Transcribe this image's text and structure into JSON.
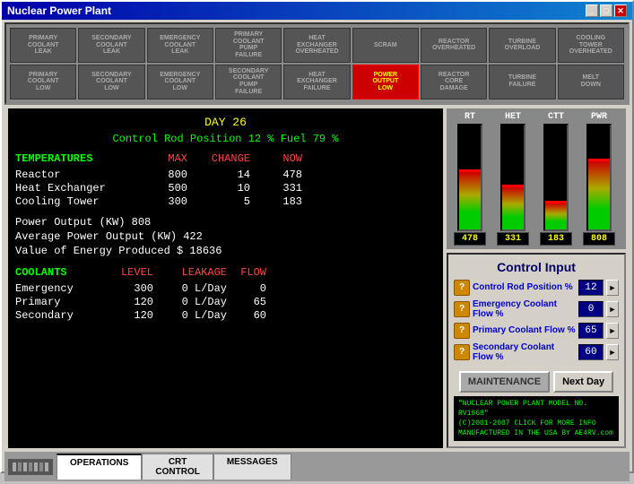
{
  "window": {
    "title": "Nuclear Power Plant",
    "min_btn": "_",
    "max_btn": "□",
    "close_btn": "✕"
  },
  "alerts": {
    "row1": [
      {
        "label": "PRIMARY\nCOOLANT\nLEAK",
        "active": false
      },
      {
        "label": "SECONDARY\nCOOLANT\nLEAK",
        "active": false
      },
      {
        "label": "EMERGENCY\nCOOLANT\nLEAK",
        "active": false
      },
      {
        "label": "PRIMARY\nCOOLANT\nPUMP\nFAILURE",
        "active": false
      },
      {
        "label": "HEAT\nEXCHANGER\nOVERHEATED",
        "active": false
      },
      {
        "label": "SCRAM",
        "active": false
      },
      {
        "label": "REACTOR\nOVERHEATED",
        "active": false
      },
      {
        "label": "TURBINE\nOVERLOAD",
        "active": false
      },
      {
        "label": "COOLING\nTOWER\nOVERHEATED",
        "active": false
      },
      {
        "label": "",
        "active": false
      }
    ],
    "row2": [
      {
        "label": "PRIMARY\nCOOLANT\nLOW",
        "active": false
      },
      {
        "label": "SECONDARY\nCOOLANT\nLOW",
        "active": false
      },
      {
        "label": "EMERGENCY\nCOOLANT\nLOW",
        "active": false
      },
      {
        "label": "SECONDARY\nCOOLANT\nPUMP\nFAILURE",
        "active": false
      },
      {
        "label": "HEAT\nEXCHANGER\nFAILURE",
        "active": false
      },
      {
        "label": "POWER\nOUTPUT\nLOW",
        "active": true
      },
      {
        "label": "REACTOR\nCORE\nDAMAGE",
        "active": false
      },
      {
        "label": "TURBINE\nFAILURE",
        "active": false
      },
      {
        "label": "MELT\nDOWN",
        "active": false
      },
      {
        "label": "",
        "active": false
      }
    ]
  },
  "info": {
    "day_label": "DAY 26",
    "rod_fuel_label": "Control Rod Position 12 %   Fuel 79 %",
    "temps_header": "TEMPERATURES",
    "col_max": "MAX",
    "col_change": "CHANGE",
    "col_now": "NOW",
    "temps": [
      {
        "name": "Reactor",
        "max": "800",
        "change": "14",
        "now": "478"
      },
      {
        "name": "Heat Exchanger",
        "max": "500",
        "change": "10",
        "now": "331"
      },
      {
        "name": "Cooling Tower",
        "max": "300",
        "change": "5",
        "now": "183"
      }
    ],
    "power_output": "Power Output            (KW) 808",
    "avg_power": "Average Power Output    (KW) 422",
    "value_energy": "Value of Energy Produced  $ 18636",
    "coolants_header": "COOLANTS",
    "col_level": "LEVEL",
    "col_leakage": "LEAKAGE",
    "col_flow": "FLOW",
    "coolants": [
      {
        "name": "Emergency",
        "level": "300",
        "leak": "0 L/Day",
        "flow": "0"
      },
      {
        "name": "Primary",
        "level": "120",
        "leak": "0 L/Day",
        "flow": "65"
      },
      {
        "name": "Secondary",
        "level": "120",
        "leak": "0 L/Day",
        "flow": "60"
      }
    ]
  },
  "gauges": [
    {
      "label": "RT",
      "value": "478",
      "fill_pct": 55,
      "arrow_pct": 55
    },
    {
      "label": "HET",
      "value": "331",
      "fill_pct": 40,
      "arrow_pct": 40
    },
    {
      "label": "CTT",
      "value": "183",
      "fill_pct": 25,
      "arrow_pct": 25
    },
    {
      "label": "PWR",
      "value": "808",
      "fill_pct": 65,
      "arrow_pct": 65
    }
  ],
  "control": {
    "title": "Control Input",
    "rows": [
      {
        "label": "Control Rod Position %",
        "value": "12"
      },
      {
        "label": "Emergency Coolant Flow %",
        "value": "0"
      },
      {
        "label": "Primary Coolant Flow %",
        "value": "65"
      },
      {
        "label": "Secondary Coolant Flow %",
        "value": "60"
      }
    ],
    "btn_maintenance": "MAINTENANCE",
    "btn_next_day": "Next Day",
    "footer": "(C)2001-2007  CLICK FOR MORE INFO\nMANUFACTURED IN THE USA BY AE4RV.com",
    "footer_line1": "\"NUCLEAR POWER PLANT  MODEL NO. RV1968\"",
    "footer_line2": "(C)2001-2007  CLICK FOR MORE INFO",
    "footer_line3": "MANUFACTURED IN THE USA BY AE4RV.com"
  },
  "tabs": [
    {
      "label": "OPERATIONS",
      "active": true
    },
    {
      "label": "CRT\nCONTROL",
      "active": false
    },
    {
      "label": "MESSAGES",
      "active": false
    }
  ]
}
